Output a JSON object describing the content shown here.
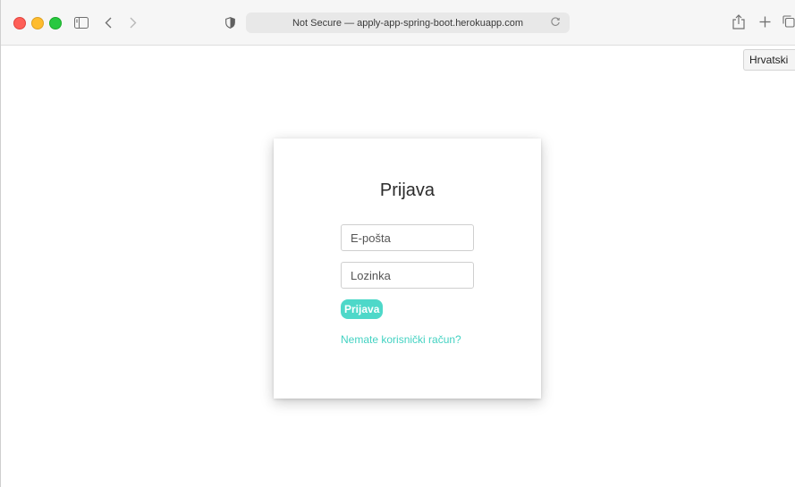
{
  "browser": {
    "url_text": "Not Secure — apply-app-spring-boot.herokuapp.com",
    "icons": {
      "sidebar": "sidebar-icon",
      "back": "chevron-left-icon",
      "forward": "chevron-right-icon",
      "privacy": "shield-icon",
      "reload": "reload-icon",
      "share": "share-icon",
      "new_tab": "plus-icon",
      "tab_overview": "tabs-icon"
    }
  },
  "translate_popover": {
    "label": "Hrvatski"
  },
  "login": {
    "title": "Prijava",
    "email_placeholder": "E-pošta",
    "password_placeholder": "Lozinka",
    "submit_label": "Prijava",
    "register_link": "Nemate korisnički račun?"
  },
  "colors": {
    "accent": "#4ed8c9",
    "link": "#43d2c2"
  }
}
